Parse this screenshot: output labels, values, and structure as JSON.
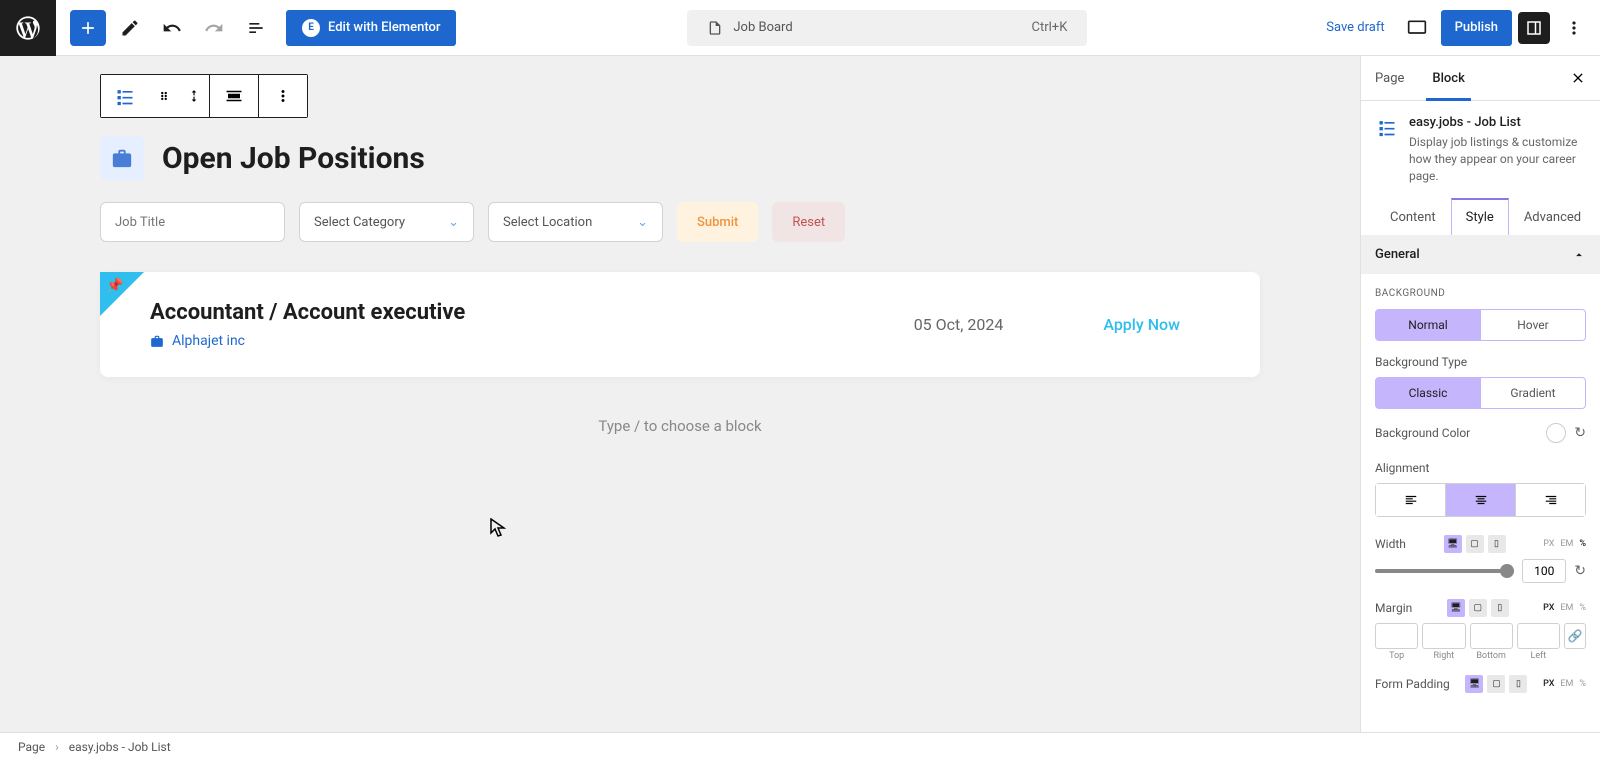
{
  "topbar": {
    "elementor_label": "Edit with Elementor",
    "doc_title": "Job Board",
    "shortcut": "Ctrl+K",
    "save_draft": "Save draft",
    "publish": "Publish"
  },
  "canvas": {
    "jb_title": "Open Job Positions",
    "job_title_placeholder": "Job Title",
    "select_category": "Select Category",
    "select_location": "Select Location",
    "submit": "Submit",
    "reset": "Reset",
    "job": {
      "title": "Accountant / Account executive",
      "company": "Alphajet inc",
      "date": "05 Oct, 2024",
      "apply": "Apply Now"
    },
    "choose_block": "Type / to choose a block"
  },
  "sidebar": {
    "tab_page": "Page",
    "tab_block": "Block",
    "block_name": "easy.jobs - Job List",
    "block_desc": "Display job listings & customize how they appear on your career page.",
    "subtab_content": "Content",
    "subtab_style": "Style",
    "subtab_advanced": "Advanced",
    "panel_general": "General",
    "background_label": "BACKGROUND",
    "normal": "Normal",
    "hover": "Hover",
    "bg_type_label": "Background Type",
    "classic": "Classic",
    "gradient": "Gradient",
    "bg_color_label": "Background Color",
    "alignment_label": "Alignment",
    "width_label": "Width",
    "width_value": "100",
    "margin_label": "Margin",
    "margin_sides": {
      "top": "Top",
      "right": "Right",
      "bottom": "Bottom",
      "left": "Left"
    },
    "form_padding_label": "Form Padding",
    "units": {
      "px": "PX",
      "em": "EM",
      "pct": "%"
    }
  },
  "breadcrumb": {
    "root": "Page",
    "current": "easy.jobs - Job List"
  }
}
